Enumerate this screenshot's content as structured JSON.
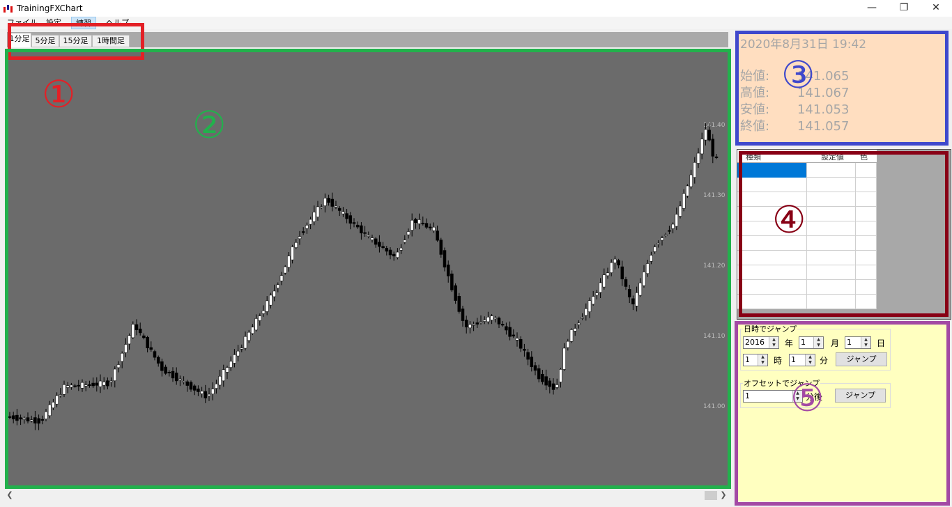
{
  "window": {
    "title": "TrainingFXChart",
    "minimize_icon": "minimize-icon",
    "maximize_icon": "restore-icon",
    "close_icon": "close-icon"
  },
  "menu": {
    "items": [
      "ファイル",
      "設定",
      "練習",
      "ヘルプ"
    ],
    "active_index": 2
  },
  "tabs": {
    "items": [
      "1分足",
      "5分足",
      "15分足",
      "1時間足"
    ],
    "selected_index": 0
  },
  "chart": {
    "background": "#6b6b6b",
    "up_color": "#ffffff",
    "down_color": "#000000",
    "price_labels": [
      "141.40",
      "141.30",
      "141.20",
      "141.10",
      "141.00"
    ]
  },
  "info": {
    "datetime": "2020年8月31日 19:42",
    "rows": [
      {
        "label": "始値:",
        "value": "141.065"
      },
      {
        "label": "高値:",
        "value": "141.067"
      },
      {
        "label": "安値:",
        "value": "141.053"
      },
      {
        "label": "終値:",
        "value": "141.057"
      }
    ]
  },
  "indicator_grid": {
    "headers": [
      "種類",
      "設定値",
      "色"
    ],
    "row_count": 10,
    "selected_row": 0
  },
  "jump": {
    "datetime_group_label": "日時でジャンプ",
    "year": "2016",
    "year_unit": "年",
    "month": "1",
    "month_unit": "月",
    "day": "1",
    "day_unit": "日",
    "hour": "1",
    "hour_unit": "時",
    "minute": "1",
    "minute_unit": "分",
    "jump_button": "ジャンプ",
    "offset_group_label": "オフセットでジャンプ",
    "offset": "1",
    "offset_unit": "分後",
    "offset_jump_button": "ジャンプ"
  },
  "annotations": [
    {
      "number": "①",
      "color": "#e32026"
    },
    {
      "number": "②",
      "color": "#22b14c"
    },
    {
      "number": "③",
      "color": "#3f48cc"
    },
    {
      "number": "④",
      "color": "#880015"
    },
    {
      "number": "⑤",
      "color": "#a349a4"
    }
  ]
}
